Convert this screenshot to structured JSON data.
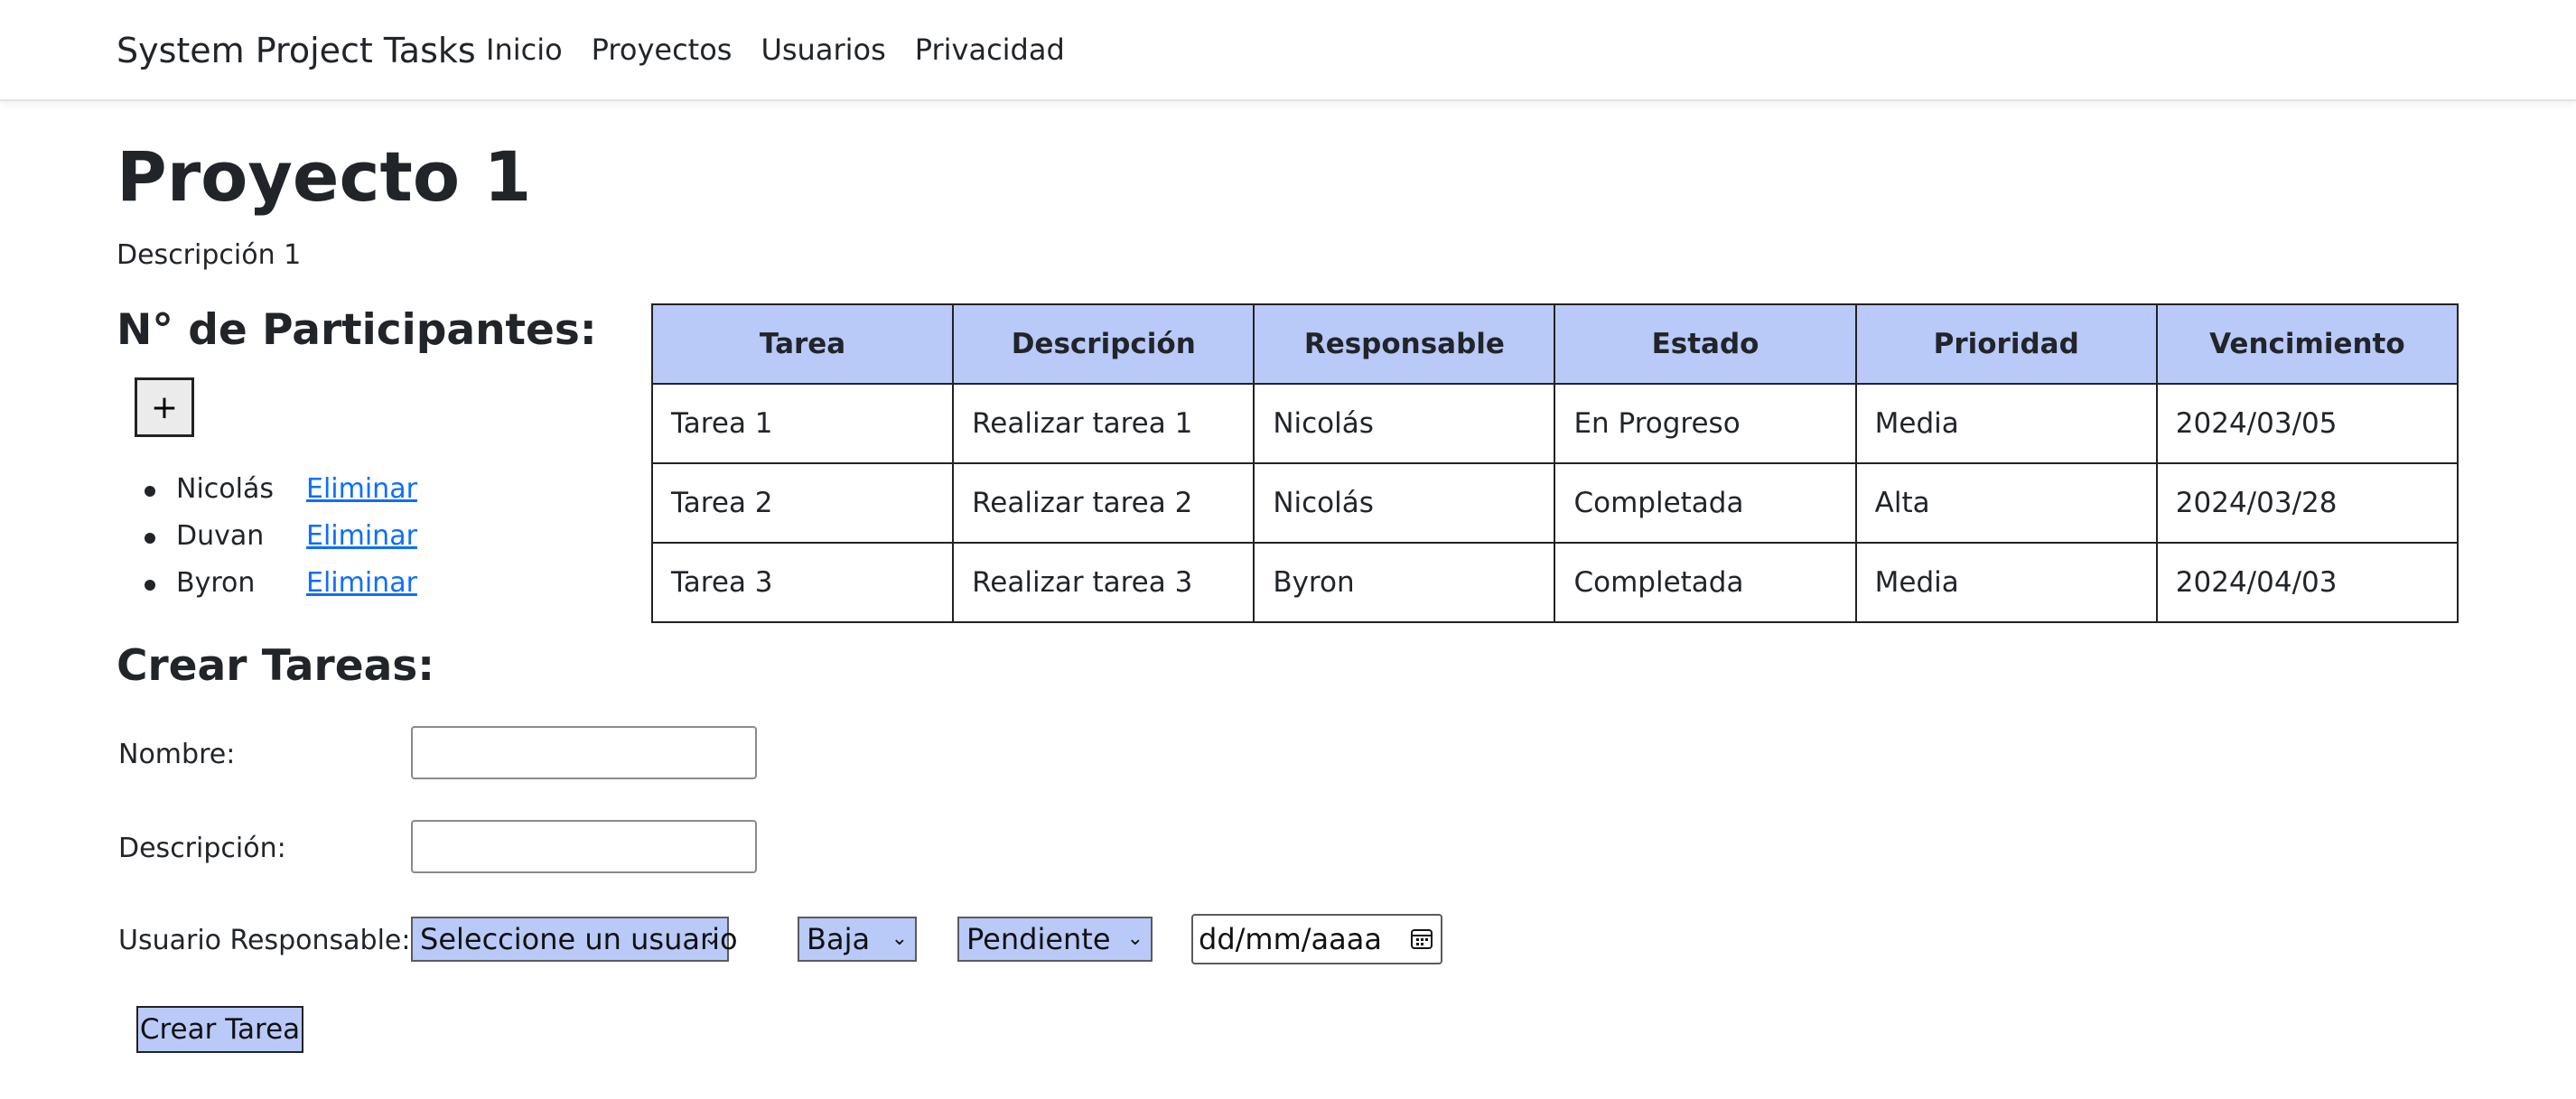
{
  "navbar": {
    "brand": "System Project Tasks",
    "links": [
      "Inicio",
      "Proyectos",
      "Usuarios",
      "Privacidad"
    ]
  },
  "project": {
    "title": "Proyecto 1",
    "description": "Descripción 1"
  },
  "participants": {
    "heading": "N° de Participantes:",
    "add_label": "+",
    "remove_label": "Eliminar",
    "items": [
      "Nicolás",
      "Duvan",
      "Byron"
    ]
  },
  "table": {
    "headers": [
      "Tarea",
      "Descripción",
      "Responsable",
      "Estado",
      "Prioridad",
      "Vencimiento"
    ],
    "rows": [
      [
        "Tarea 1",
        "Realizar tarea 1",
        "Nicolás",
        "En Progreso",
        "Media",
        "2024/03/05"
      ],
      [
        "Tarea 2",
        "Realizar tarea 2",
        "Nicolás",
        "Completada",
        "Alta",
        "2024/03/28"
      ],
      [
        "Tarea 3",
        "Realizar tarea 3",
        "Byron",
        "Completada",
        "Media",
        "2024/04/03"
      ]
    ]
  },
  "create_form": {
    "heading": "Crear Tareas:",
    "name_label": "Nombre:",
    "name_value": "",
    "description_label": "Descripción:",
    "description_value": "",
    "user_label": "Usuario Responsable:",
    "user_select": "Seleccione un usuario",
    "priority_select": "Baja",
    "status_select": "Pendiente",
    "date_placeholder": "dd/mm/aaaa",
    "submit_label": "Crear Tarea"
  },
  "colors": {
    "header_bg": "#b9caf9",
    "link": "#0d6efd",
    "text": "#212529"
  },
  "icons": {
    "calendar": "calendar-icon",
    "select_arrow": "chevron-down-icon"
  }
}
